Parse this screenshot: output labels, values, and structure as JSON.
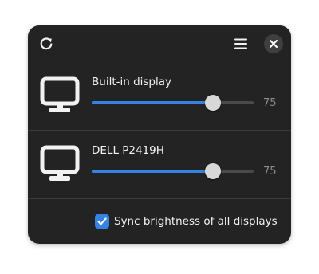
{
  "header": {
    "refresh_icon": "refresh-icon",
    "menu_icon": "hamburger-menu-icon",
    "close_icon": "close-icon"
  },
  "displays": [
    {
      "name": "Built-in display",
      "brightness": 75,
      "icon": "monitor-icon"
    },
    {
      "name": "DELL P2419H",
      "brightness": 75,
      "icon": "monitor-icon"
    }
  ],
  "sync": {
    "label": "Sync brightness of all displays",
    "checked": true
  },
  "colors": {
    "background": "#232323",
    "accent": "#3584e4",
    "text": "#f2f2f2",
    "muted_text": "#8c8c8c"
  }
}
